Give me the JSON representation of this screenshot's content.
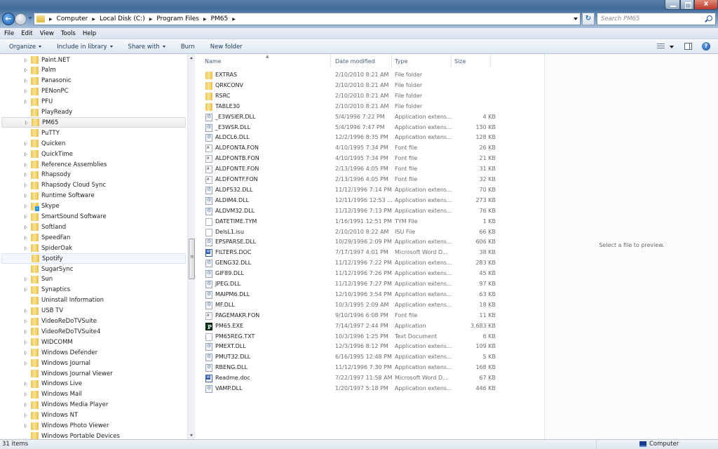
{
  "window": {
    "close_glyph": "x"
  },
  "address": {
    "crumbs": [
      "Computer",
      "Local Disk (C:)",
      "Program Files",
      "PM65"
    ],
    "search_placeholder": "Search PM65"
  },
  "menubar": [
    "File",
    "Edit",
    "View",
    "Tools",
    "Help"
  ],
  "toolbar": {
    "organize": "Organize",
    "include_in_library": "Include in library",
    "share_with": "Share with",
    "burn": "Burn",
    "new_folder": "New folder"
  },
  "nav_tree": [
    {
      "label": "Paint.NET",
      "expandable": true
    },
    {
      "label": "Palm",
      "expandable": true
    },
    {
      "label": "Panasonic",
      "expandable": true
    },
    {
      "label": "PENonPC",
      "expandable": true
    },
    {
      "label": "PFU",
      "expandable": true
    },
    {
      "label": "PlayReady",
      "expandable": false
    },
    {
      "label": "PM65",
      "expandable": true,
      "selected": true
    },
    {
      "label": "PuTTY",
      "expandable": false
    },
    {
      "label": "Quicken",
      "expandable": true
    },
    {
      "label": "QuickTime",
      "expandable": true
    },
    {
      "label": "Reference Assemblies",
      "expandable": true
    },
    {
      "label": "Rhapsody",
      "expandable": true
    },
    {
      "label": "Rhapsody Cloud Sync",
      "expandable": true
    },
    {
      "label": "Runtime Software",
      "expandable": true
    },
    {
      "label": "Skype",
      "expandable": true,
      "icon": "skype"
    },
    {
      "label": "SmartSound Software",
      "expandable": true
    },
    {
      "label": "Softland",
      "expandable": true
    },
    {
      "label": "SpeedFan",
      "expandable": true
    },
    {
      "label": "SpiderOak",
      "expandable": true
    },
    {
      "label": "Spotify",
      "expandable": false,
      "hover": true
    },
    {
      "label": "SugarSync",
      "expandable": false
    },
    {
      "label": "Sun",
      "expandable": true
    },
    {
      "label": "Synaptics",
      "expandable": true
    },
    {
      "label": "Uninstall Information",
      "expandable": false
    },
    {
      "label": "USB TV",
      "expandable": true
    },
    {
      "label": "VideoReDoTVSuite",
      "expandable": true
    },
    {
      "label": "VideoReDoTVSuite4",
      "expandable": true
    },
    {
      "label": "WIDCOMM",
      "expandable": true
    },
    {
      "label": "Windows Defender",
      "expandable": true
    },
    {
      "label": "Windows Journal",
      "expandable": true
    },
    {
      "label": "Windows Journal Viewer",
      "expandable": false
    },
    {
      "label": "Windows Live",
      "expandable": true
    },
    {
      "label": "Windows Mail",
      "expandable": true
    },
    {
      "label": "Windows Media Player",
      "expandable": true
    },
    {
      "label": "Windows NT",
      "expandable": true
    },
    {
      "label": "Windows Photo Viewer",
      "expandable": true
    },
    {
      "label": "Windows Portable Devices",
      "expandable": false
    }
  ],
  "columns": {
    "name": "Name",
    "date": "Date modified",
    "type": "Type",
    "size": "Size"
  },
  "files": [
    {
      "name": "EXTRAS",
      "date": "2/10/2010 8:21 AM",
      "type": "File folder",
      "size": "",
      "icon": "folder"
    },
    {
      "name": "QRKCONV",
      "date": "2/10/2010 8:21 AM",
      "type": "File folder",
      "size": "",
      "icon": "folder"
    },
    {
      "name": "RSRC",
      "date": "2/10/2010 8:21 AM",
      "type": "File folder",
      "size": "",
      "icon": "folder"
    },
    {
      "name": "TABLE30",
      "date": "2/10/2010 8:21 AM",
      "type": "File folder",
      "size": "",
      "icon": "folder"
    },
    {
      "name": "_E3WSIER.DLL",
      "date": "5/4/1996 7:22 PM",
      "type": "Application extens...",
      "size": "4 KB",
      "icon": "dll"
    },
    {
      "name": "_E3WSR.DLL",
      "date": "5/4/1996 7:47 PM",
      "type": "Application extens...",
      "size": "130 KB",
      "icon": "dll"
    },
    {
      "name": "ALDCL6.DLL",
      "date": "12/2/1996 8:35 PM",
      "type": "Application extens...",
      "size": "128 KB",
      "icon": "dll"
    },
    {
      "name": "ALDFONTA.FON",
      "date": "4/10/1995 7:34 PM",
      "type": "Font file",
      "size": "26 KB",
      "icon": "font"
    },
    {
      "name": "ALDFONTB.FON",
      "date": "4/10/1995 7:34 PM",
      "type": "Font file",
      "size": "21 KB",
      "icon": "font"
    },
    {
      "name": "ALDFONTE.FON",
      "date": "2/13/1996 4:05 PM",
      "type": "Font file",
      "size": "31 KB",
      "icon": "font"
    },
    {
      "name": "ALDFONTF.FON",
      "date": "2/13/1996 4:05 PM",
      "type": "Font file",
      "size": "32 KB",
      "icon": "font"
    },
    {
      "name": "ALDFS32.DLL",
      "date": "11/12/1996 7:14 PM",
      "type": "Application extens...",
      "size": "70 KB",
      "icon": "dll"
    },
    {
      "name": "ALDIM4.DLL",
      "date": "12/11/1996 12:53 ...",
      "type": "Application extens...",
      "size": "273 KB",
      "icon": "dll"
    },
    {
      "name": "ALDVM32.DLL",
      "date": "11/12/1996 7:13 PM",
      "type": "Application extens...",
      "size": "76 KB",
      "icon": "dll"
    },
    {
      "name": "DATETIME.TYM",
      "date": "1/16/1991 12:51 PM",
      "type": "TYM File",
      "size": "1 KB",
      "icon": "blank"
    },
    {
      "name": "DelsL1.isu",
      "date": "2/10/2010 8:22 AM",
      "type": "ISU File",
      "size": "66 KB",
      "icon": "blank"
    },
    {
      "name": "EPSPARSE.DLL",
      "date": "10/29/1996 2:09 PM",
      "type": "Application extens...",
      "size": "606 KB",
      "icon": "dll"
    },
    {
      "name": "FILTERS.DOC",
      "date": "7/17/1997 4:01 PM",
      "type": "Microsoft Word D...",
      "size": "38 KB",
      "icon": "doc"
    },
    {
      "name": "GENG32.DLL",
      "date": "11/12/1996 7:22 PM",
      "type": "Application extens...",
      "size": "283 KB",
      "icon": "dll"
    },
    {
      "name": "GIF89.DLL",
      "date": "11/12/1996 7:26 PM",
      "type": "Application extens...",
      "size": "45 KB",
      "icon": "dll"
    },
    {
      "name": "JPEG.DLL",
      "date": "11/12/1996 7:27 PM",
      "type": "Application extens...",
      "size": "97 KB",
      "icon": "dll"
    },
    {
      "name": "MAIPM6.DLL",
      "date": "12/10/1996 3:54 PM",
      "type": "Application extens...",
      "size": "63 KB",
      "icon": "dll"
    },
    {
      "name": "MF.DLL",
      "date": "10/3/1995 2:09 AM",
      "type": "Application extens...",
      "size": "18 KB",
      "icon": "dll"
    },
    {
      "name": "PAGEMAKR.FON",
      "date": "9/10/1996 6:08 PM",
      "type": "Font file",
      "size": "11 KB",
      "icon": "font"
    },
    {
      "name": "PM65.EXE",
      "date": "7/14/1997 2:44 PM",
      "type": "Application",
      "size": "3,683 KB",
      "icon": "exe"
    },
    {
      "name": "PM65REG.TXT",
      "date": "10/3/1996 1:25 PM",
      "type": "Text Document",
      "size": "6 KB",
      "icon": "blank"
    },
    {
      "name": "PMEXT.DLL",
      "date": "12/3/1996 8:12 PM",
      "type": "Application extens...",
      "size": "109 KB",
      "icon": "dll"
    },
    {
      "name": "PMUT32.DLL",
      "date": "6/16/1995 12:48 PM",
      "type": "Application extens...",
      "size": "5 KB",
      "icon": "dll"
    },
    {
      "name": "RBENG.DLL",
      "date": "11/12/1996 7:30 PM",
      "type": "Application extens...",
      "size": "168 KB",
      "icon": "dll"
    },
    {
      "name": "Readme.doc",
      "date": "7/22/1997 11:58 AM",
      "type": "Microsoft Word D...",
      "size": "67 KB",
      "icon": "doc"
    },
    {
      "name": "VAMP.DLL",
      "date": "1/20/1997 5:18 PM",
      "type": "Application extens...",
      "size": "446 KB",
      "icon": "dll"
    }
  ],
  "preview": {
    "message": "Select a file to preview."
  },
  "status": {
    "item_count": "31 items",
    "zone": "Computer"
  }
}
